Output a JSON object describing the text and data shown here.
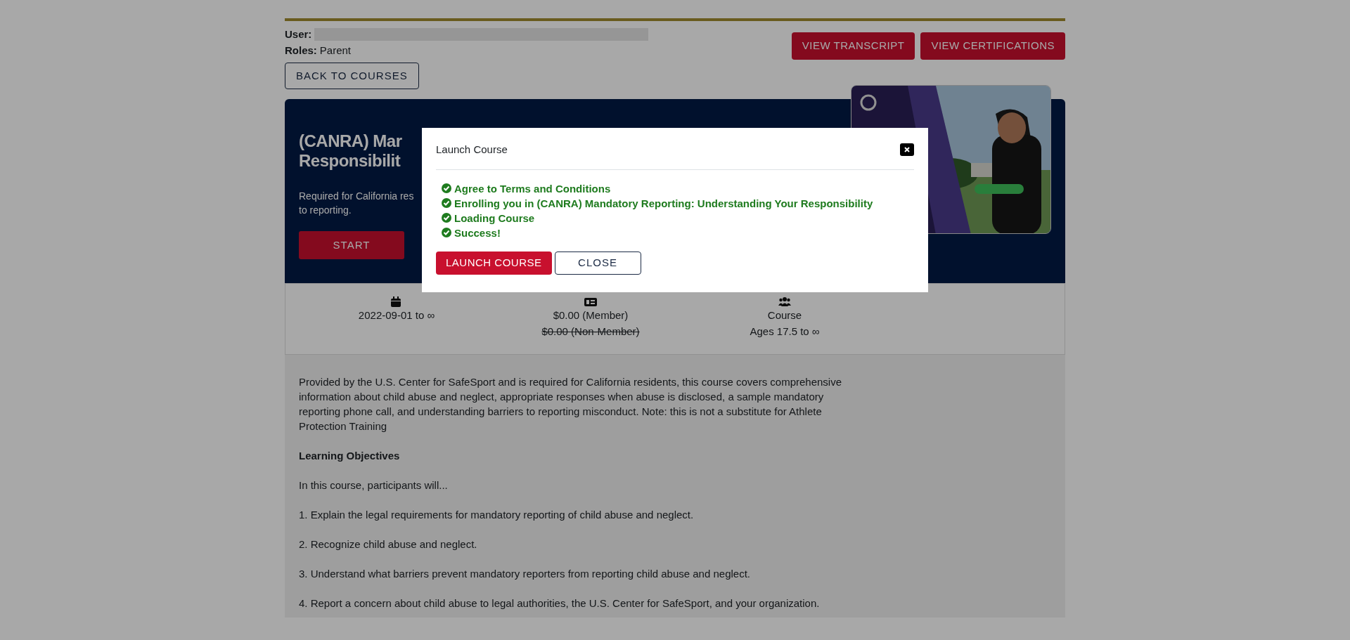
{
  "header": {
    "user_label": "User:",
    "roles_label": "Roles:",
    "roles_value": "Parent",
    "buttons": [
      {
        "label": "VIEW TRANSCRIPT"
      },
      {
        "label": "VIEW CERTIFICATIONS"
      }
    ],
    "back_button": "BACK TO COURSES"
  },
  "hero": {
    "title_lines": [
      "(CANRA) Mar",
      "Responsibilit"
    ],
    "description_lines": [
      "Required for California res",
      "to reporting."
    ],
    "start_button": "START",
    "image": {
      "kind": "picture"
    }
  },
  "info": [
    {
      "kind": "dates",
      "lines": [
        "2022-09-01 to ∞"
      ]
    },
    {
      "kind": "price",
      "lines": [
        "$0.00 (Member)",
        "$0.00 (Non-Member)"
      ],
      "struck": [
        false,
        true
      ]
    },
    {
      "kind": "audience",
      "lines": [
        "Course",
        "Ages 17.5 to ∞"
      ]
    }
  ],
  "body": [
    {
      "kind": "text",
      "text": "Provided by the U.S. Center for SafeSport and is required for California residents, this course covers comprehensive information about child abuse and neglect, appropriate responses when abuse is disclosed, a sample mandatory reporting phone call, and understanding barriers to reporting misconduct. Note: this is not a substitute for Athlete Protection Training"
    },
    {
      "kind": "heading",
      "text": "Learning Objectives"
    },
    {
      "kind": "text",
      "text": "In this course, participants will..."
    },
    {
      "kind": "text",
      "text": "1. Explain the legal requirements for mandatory reporting of child abuse and neglect."
    },
    {
      "kind": "text",
      "text": "2. Recognize child abuse and neglect."
    },
    {
      "kind": "text",
      "text": "3. Understand what barriers prevent mandatory reporters from reporting child abuse and neglect."
    },
    {
      "kind": "text",
      "text": "4. Report a concern about child abuse to legal authorities, the U.S. Center for SafeSport, and your organization."
    }
  ],
  "modal": {
    "title": "Launch Course",
    "steps": [
      {
        "text": "Agree to Terms and Conditions",
        "done": true
      },
      {
        "text": "Enrolling you in (CANRA) Mandatory Reporting: Understanding Your Responsibility",
        "done": true
      },
      {
        "text": "Loading Course",
        "done": true
      },
      {
        "text": "Success!",
        "done": true
      }
    ],
    "buttons": [
      {
        "label": "LAUNCH COURSE",
        "kind": "primary"
      },
      {
        "label": "CLOSE",
        "kind": "outline"
      }
    ]
  }
}
